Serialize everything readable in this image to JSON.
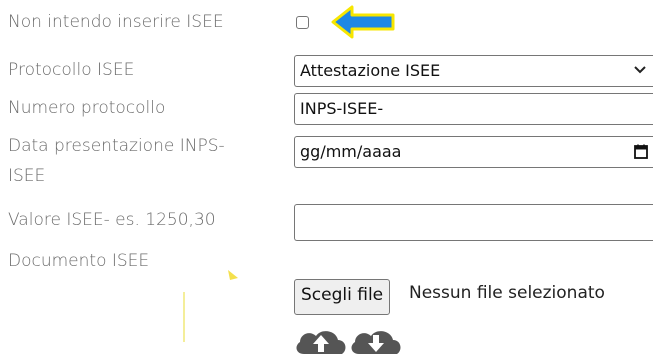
{
  "form": {
    "opt_out_label": "Non intendo inserire ISEE",
    "protocol_type_label": "Protocollo ISEE",
    "protocol_type_value": "Attestazione ISEE",
    "protocol_number_label": "Numero protocollo",
    "protocol_number_value": "INPS-ISEE-",
    "date_label_line1": "Data presentazione INPS-",
    "date_label_line2": "ISEE",
    "date_placeholder": "gg/mm/aaaa",
    "value_label": "Valore ISEE- es. 1250,30",
    "value_input": "",
    "document_label": "Documento ISEE",
    "choose_file_label": "Scegli file",
    "no_file_text": "Nessun file selezionato"
  },
  "icons": {
    "arrow": "arrow-left-icon",
    "calendar": "calendar-icon",
    "chevron": "chevron-down-icon",
    "upload": "cloud-upload-icon",
    "download": "cloud-download-icon"
  },
  "colors": {
    "arrow_fill": "#1e88e5",
    "arrow_outline": "#f7e600",
    "cloud": "#555555"
  }
}
